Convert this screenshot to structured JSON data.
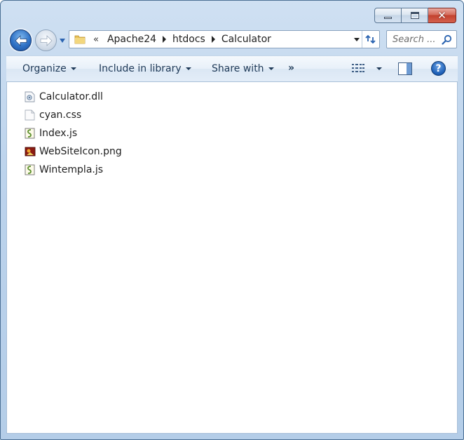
{
  "window": {
    "caption": {
      "minimize": "minimize",
      "maximize": "maximize",
      "close": "✕"
    }
  },
  "nav": {
    "breadcrumb_overflow": "«",
    "breadcrumbs": [
      "Apache24",
      "htdocs",
      "Calculator"
    ],
    "search_placeholder": "Search ..."
  },
  "toolbar": {
    "organize": "Organize",
    "include_in_library": "Include in library",
    "share_with": "Share with",
    "more": "»",
    "help": "?"
  },
  "files": [
    {
      "name": "Calculator.dll",
      "icon": "dll-file-icon"
    },
    {
      "name": "cyan.css",
      "icon": "css-file-icon"
    },
    {
      "name": "Index.js",
      "icon": "js-file-icon"
    },
    {
      "name": "WebSiteIcon.png",
      "icon": "png-file-icon"
    },
    {
      "name": "Wintempla.js",
      "icon": "js-file-icon"
    }
  ],
  "colors": {
    "frame": "#bcd3ec",
    "toolbar": "#e3edf8",
    "accent": "#2f72c6",
    "close": "#c2412e"
  }
}
